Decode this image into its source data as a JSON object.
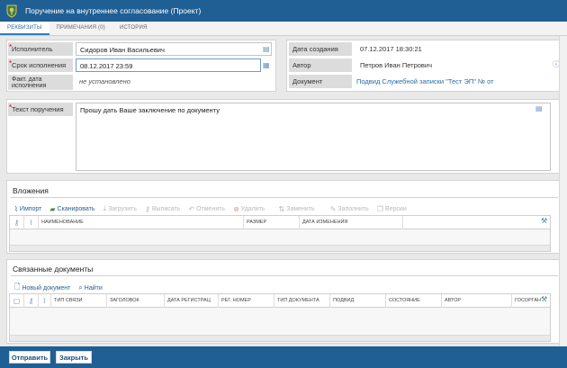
{
  "window": {
    "title": "Поручение на внутреннее согласование (Проект)"
  },
  "tabs": [
    {
      "label": "РЕКВИЗИТЫ",
      "active": true
    },
    {
      "label": "ПРИМЕЧАНИЯ (0)",
      "active": false
    },
    {
      "label": "ИСТОРИЯ",
      "active": false
    }
  ],
  "form": {
    "executor": {
      "label": "Исполнитель",
      "value": "Сидоров Иван Васильевич"
    },
    "deadline": {
      "label": "Срок исполнения",
      "value": "08.12.2017 23:59"
    },
    "actual_date": {
      "label": "Факт. дата исполнения",
      "value": "не установлено"
    },
    "created": {
      "label": "Дата создания",
      "value": "07.12.2017 18:30:21"
    },
    "author": {
      "label": "Автор",
      "value": "Петров Иван Петрович"
    },
    "document": {
      "label": "Документ",
      "value": "Подвид Служебной записки \"Тест ЭП\" № от"
    },
    "task_text": {
      "label": "Текст поручения",
      "value": "Прошу дать Ваше заключение по документу"
    }
  },
  "attachments": {
    "title": "Вложения",
    "toolbar": [
      {
        "label": "Импорт",
        "icon": "paperclip-icon",
        "enabled": true
      },
      {
        "label": "Сканировать",
        "icon": "scanner-icon",
        "enabled": true
      },
      {
        "label": "Загрузить",
        "icon": "download-icon",
        "enabled": false
      },
      {
        "label": "Выписать",
        "icon": "key-icon",
        "enabled": false
      },
      {
        "label": "Отменить",
        "icon": "undo-icon",
        "enabled": false
      },
      {
        "label": "Удалить",
        "icon": "delete-icon",
        "enabled": false
      },
      {
        "label": "Заменить",
        "icon": "replace-icon",
        "enabled": false
      },
      {
        "label": "Заполнить",
        "icon": "fill-icon",
        "enabled": false
      },
      {
        "label": "Версии",
        "icon": "versions-icon",
        "enabled": false
      }
    ],
    "columns": [
      "Наименование",
      "Размер",
      "Дата изменения"
    ]
  },
  "related": {
    "title": "Связанные документы",
    "toolbar": [
      {
        "label": "Новый документ",
        "icon": "new-document-icon",
        "enabled": true
      },
      {
        "label": "Найти",
        "icon": "search-icon",
        "enabled": true
      }
    ],
    "columns": [
      "Тип связи",
      "Заголовок",
      "Дата регистрац",
      "Рег. номер",
      "Тип документа",
      "Подвид",
      "Состояние",
      "Автор",
      "Госорган"
    ]
  },
  "buttons": {
    "send": "Отправить",
    "close": "Закрыть"
  },
  "colors": {
    "header": "#1f5f94",
    "accent": "#2f7fb8",
    "required": "#dd0000"
  }
}
